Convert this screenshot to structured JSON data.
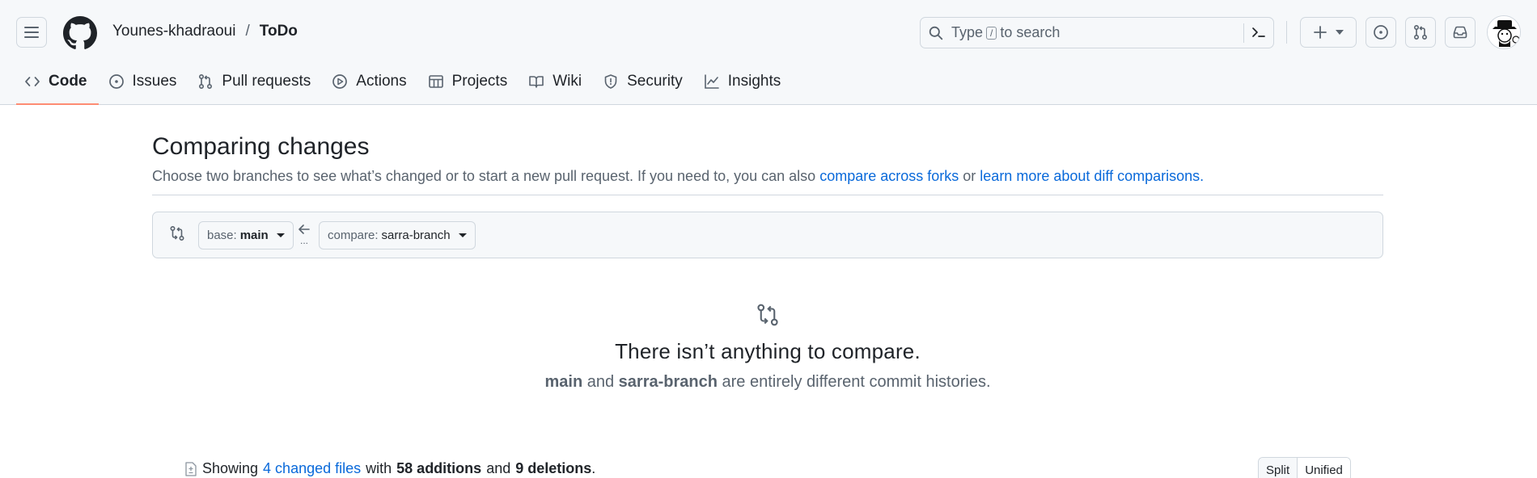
{
  "header": {
    "owner": "Younes-khadraoui",
    "separator": "/",
    "repo": "ToDo",
    "search_prefix": "Type",
    "search_key": "/",
    "search_suffix": "to search"
  },
  "tabs": [
    {
      "label": "Code",
      "icon": "code-icon",
      "active": true
    },
    {
      "label": "Issues",
      "icon": "issue-icon"
    },
    {
      "label": "Pull requests",
      "icon": "pull-request-icon"
    },
    {
      "label": "Actions",
      "icon": "play-icon"
    },
    {
      "label": "Projects",
      "icon": "table-icon"
    },
    {
      "label": "Wiki",
      "icon": "book-icon"
    },
    {
      "label": "Security",
      "icon": "shield-icon"
    },
    {
      "label": "Insights",
      "icon": "graph-icon"
    }
  ],
  "page": {
    "title": "Comparing changes",
    "subtitle_text": "Choose two branches to see what’s changed or to start a new pull request. If you need to, you can also",
    "link_forks": "compare across forks",
    "subtitle_or": "or",
    "link_learn": "learn more about diff comparisons",
    "subtitle_end": "."
  },
  "range": {
    "base_prefix": "base:",
    "base_branch": "main",
    "arrow_dots": "...",
    "compare_prefix": "compare:",
    "compare_branch": "sarra-branch"
  },
  "blankslate": {
    "heading": "There isn’t anything to compare.",
    "branch_a": "main",
    "conj": "and",
    "branch_b": "sarra-branch",
    "tail": "are entirely different commit histories."
  },
  "toc": {
    "showing": "Showing",
    "files_link": "4 changed files",
    "with": "with",
    "additions": "58 additions",
    "and": "and",
    "deletions": "9 deletions",
    "end": "."
  },
  "view_toggle": {
    "split": "Split",
    "unified": "Unified",
    "selected": "Unified"
  },
  "colors": {
    "link": "#0969da",
    "active_tab_underline": "#fd8c73",
    "border": "#d0d7de"
  }
}
